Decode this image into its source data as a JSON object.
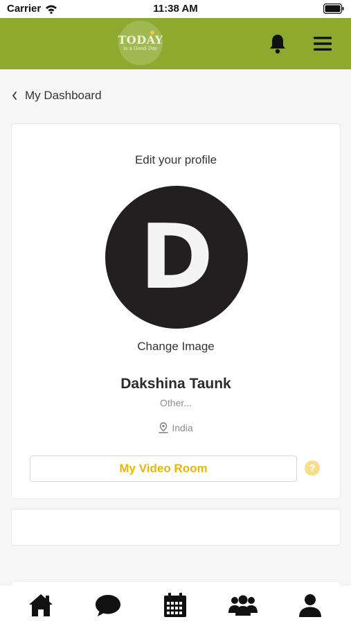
{
  "status_bar": {
    "carrier": "Carrier",
    "time": "11:38 AM"
  },
  "header": {
    "logo_text": "TODAY",
    "logo_subtext": "is a Good Day",
    "bell_icon": "bell-icon",
    "menu_icon": "hamburger-menu-icon",
    "background_color": "#8cab2e"
  },
  "nav": {
    "back_label": "My Dashboard"
  },
  "profile": {
    "edit_title": "Edit your profile",
    "avatar_initial": "D",
    "change_image_label": "Change Image",
    "name": "Dakshina Taunk",
    "gender": "Other...",
    "location": "India",
    "video_room_label": "My Video Room",
    "help_label": "?",
    "accent_color": "#e9b700"
  },
  "tab_bar": {
    "items": [
      {
        "icon": "home-icon"
      },
      {
        "icon": "chat-icon"
      },
      {
        "icon": "calendar-icon"
      },
      {
        "icon": "group-icon"
      },
      {
        "icon": "profile-icon"
      }
    ]
  }
}
